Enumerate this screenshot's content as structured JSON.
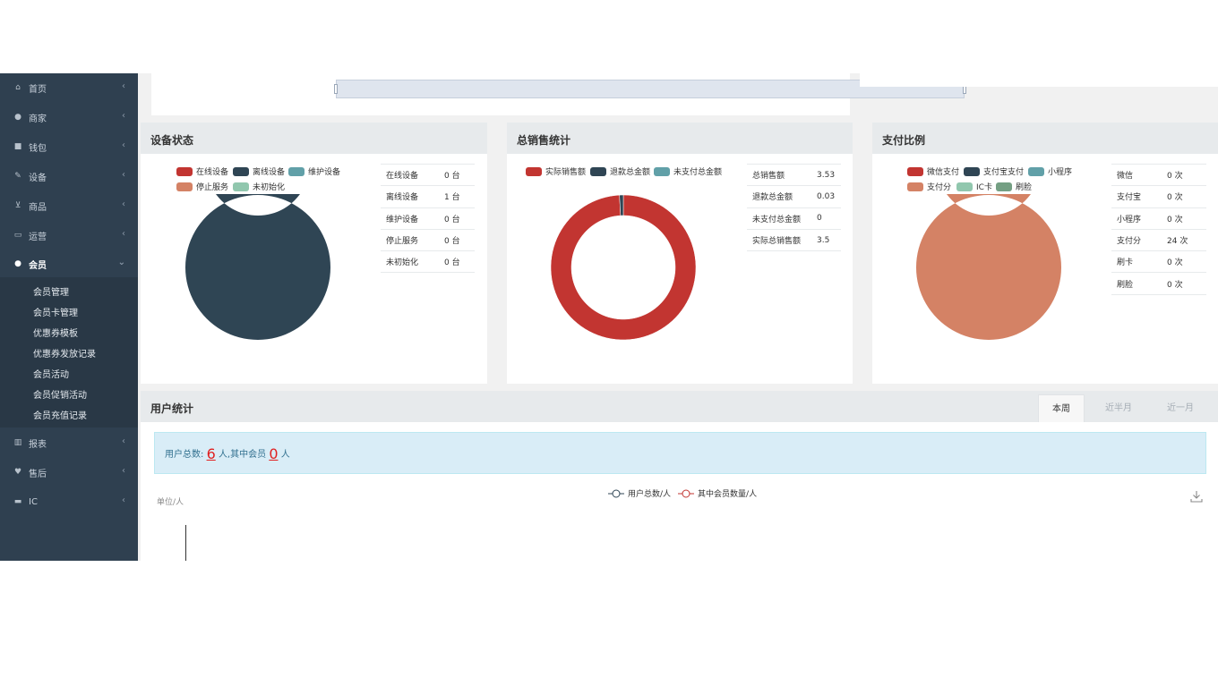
{
  "sidebar": {
    "items": [
      {
        "label": "首页",
        "icon": "home-icon"
      },
      {
        "label": "商家",
        "icon": "user-icon"
      },
      {
        "label": "钱包",
        "icon": "briefcase-icon"
      },
      {
        "label": "设备",
        "icon": "wrench-icon"
      },
      {
        "label": "商品",
        "icon": "cart-icon"
      },
      {
        "label": "运营",
        "icon": "monitor-icon"
      },
      {
        "label": "会员",
        "icon": "user-icon"
      },
      {
        "label": "报表",
        "icon": "bar-chart-icon"
      },
      {
        "label": "售后",
        "icon": "heart-icon"
      },
      {
        "label": "IC",
        "icon": "credit-card-icon"
      }
    ],
    "submenu": [
      "会员管理",
      "会员卡管理",
      "优惠券模板",
      "优惠券发放记录",
      "会员活动",
      "会员促销活动",
      "会员充值记录"
    ]
  },
  "device_panel": {
    "title": "设备状态",
    "legend": [
      "在线设备",
      "离线设备",
      "维护设备",
      "停止服务",
      "未初始化"
    ],
    "colors": [
      "#c23531",
      "#2f4554",
      "#61a0a8",
      "#d48265",
      "#91c7ae"
    ],
    "rows": [
      {
        "label": "在线设备",
        "value": "0 台"
      },
      {
        "label": "离线设备",
        "value": "1 台"
      },
      {
        "label": "维护设备",
        "value": "0 台"
      },
      {
        "label": "停止服务",
        "value": "0 台"
      },
      {
        "label": "未初始化",
        "value": "0 台"
      }
    ],
    "chart_data": {
      "type": "pie",
      "categories": [
        "在线设备",
        "离线设备",
        "维护设备",
        "停止服务",
        "未初始化"
      ],
      "values": [
        0,
        1,
        0,
        0,
        0
      ]
    }
  },
  "sales_panel": {
    "title": "总销售统计",
    "legend": [
      "实际销售额",
      "退款总金额",
      "未支付总金额"
    ],
    "colors": [
      "#c23531",
      "#2f4554",
      "#61a0a8"
    ],
    "rows": [
      {
        "label": "总销售额",
        "value": "3.53"
      },
      {
        "label": "退款总金额",
        "value": "0.03"
      },
      {
        "label": "未支付总金额",
        "value": "0"
      },
      {
        "label": "实际总销售额",
        "value": "3.5"
      }
    ],
    "chart_data": {
      "type": "pie",
      "categories": [
        "实际销售额",
        "退款总金额",
        "未支付总金额"
      ],
      "values": [
        3.5,
        0.03,
        0
      ]
    }
  },
  "payment_panel": {
    "title": "支付比例",
    "legend": [
      "微信支付",
      "支付宝支付",
      "小程序",
      "支付分",
      "IC卡",
      "刷脸"
    ],
    "colors": [
      "#c23531",
      "#2f4554",
      "#61a0a8",
      "#d48265",
      "#91c7ae",
      "#749f83"
    ],
    "rows": [
      {
        "label": "微信",
        "value": "0 次"
      },
      {
        "label": "支付宝",
        "value": "0 次"
      },
      {
        "label": "小程序",
        "value": "0 次"
      },
      {
        "label": "支付分",
        "value": "24 次"
      },
      {
        "label": "刷卡",
        "value": "0 次"
      },
      {
        "label": "刷脸",
        "value": "0 次"
      }
    ],
    "chart_data": {
      "type": "pie",
      "categories": [
        "微信支付",
        "支付宝支付",
        "小程序",
        "支付分",
        "IC卡",
        "刷脸"
      ],
      "values": [
        0,
        0,
        0,
        24,
        0,
        0
      ]
    }
  },
  "user_panel": {
    "title": "用户统计",
    "tabs": [
      "本周",
      "近半月",
      "近一月"
    ],
    "alert_prefix": "用户总数:",
    "total_users": "6",
    "alert_mid": "人,其中会员",
    "member_users": "0",
    "alert_suffix": "人",
    "unit": "单位/人",
    "legend": [
      "用户总数/人",
      "其中会员数量/人"
    ],
    "series_colors": [
      "#2f4554",
      "#c23531"
    ]
  }
}
